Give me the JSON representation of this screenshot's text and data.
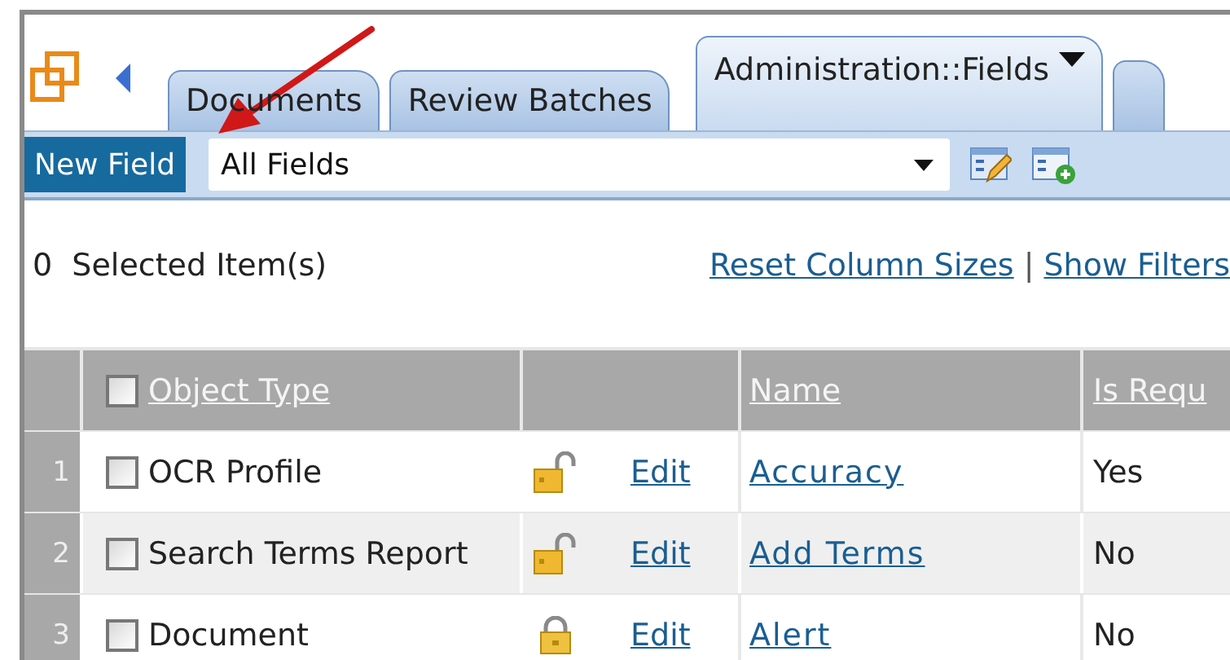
{
  "tabs": [
    {
      "label": "Documents",
      "selected": false,
      "dropdown": false
    },
    {
      "label": "Review Batches",
      "selected": false,
      "dropdown": false
    },
    {
      "label": "Administration::Fields",
      "selected": true,
      "dropdown": true
    }
  ],
  "toolbar": {
    "new_button": "New Field",
    "view_select": {
      "value": "All Fields"
    }
  },
  "selection_count": "0  Selected Item(s)",
  "links": [
    "Reset Column Sizes",
    "Show Filters"
  ],
  "link_separator": "|",
  "table": {
    "select_all_checked": false,
    "columns": [
      "Object Type",
      "Name",
      "Is Requ"
    ],
    "rows": [
      {
        "number": "1",
        "checked": false,
        "object_type": "OCR Profile",
        "locked": false,
        "edit": "Edit",
        "name": "Accuracy",
        "is_required": "Yes"
      },
      {
        "number": "2",
        "checked": false,
        "object_type": "Search Terms Report",
        "locked": false,
        "edit": "Edit",
        "name": "Add Terms",
        "is_required": "No"
      },
      {
        "number": "3",
        "checked": false,
        "object_type": "Document",
        "locked": true,
        "edit": "Edit",
        "name": "Alert",
        "is_required": "No"
      }
    ]
  }
}
